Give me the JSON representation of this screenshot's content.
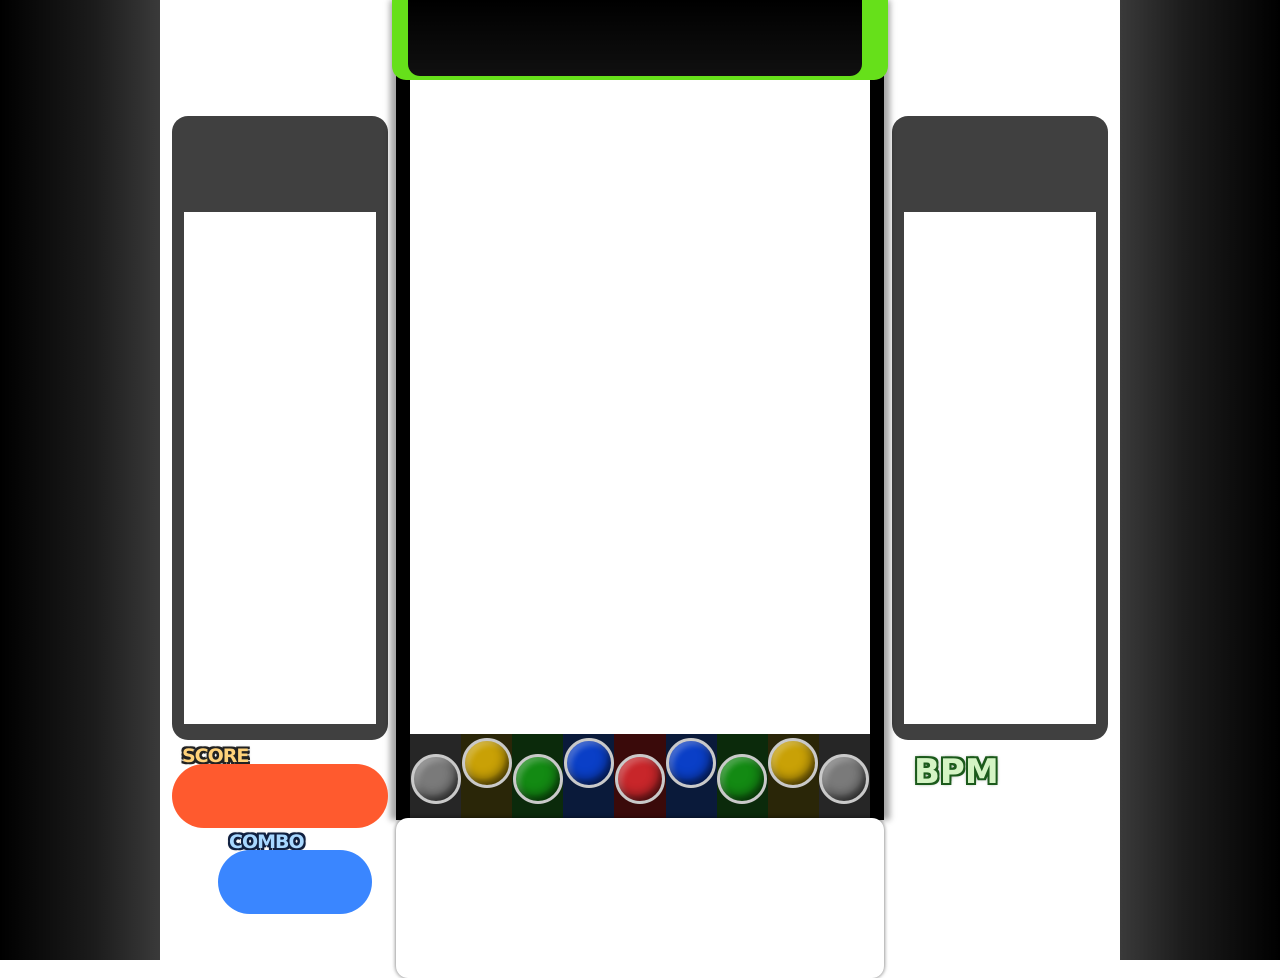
{
  "hud": {
    "score_label": "SCORE",
    "combo_label": "COMBO",
    "bpm_label": "BPM"
  },
  "colors": {
    "frame_accent": "#66e01a",
    "score_pill": "#ff5a2e",
    "combo_pill": "#3a86ff",
    "panel_frame": "#404040"
  },
  "lanes": [
    {
      "key": "gray",
      "color": "#7a7a7a",
      "lane_tint": "#262626"
    },
    {
      "key": "yellow",
      "color": "#c9a106",
      "lane_tint": "#2a2608"
    },
    {
      "key": "green",
      "color": "#138a13",
      "lane_tint": "#0b2a0b"
    },
    {
      "key": "blue",
      "color": "#0a3fc7",
      "lane_tint": "#0a1a3a"
    },
    {
      "key": "red",
      "color": "#c8262a",
      "lane_tint": "#3a0a0a"
    },
    {
      "key": "blue",
      "color": "#0a3fc7",
      "lane_tint": "#0a1a3a"
    },
    {
      "key": "green",
      "color": "#138a13",
      "lane_tint": "#0b2a0b"
    },
    {
      "key": "yellow",
      "color": "#c9a106",
      "lane_tint": "#2a2608"
    },
    {
      "key": "gray",
      "color": "#7a7a7a",
      "lane_tint": "#262626"
    }
  ]
}
